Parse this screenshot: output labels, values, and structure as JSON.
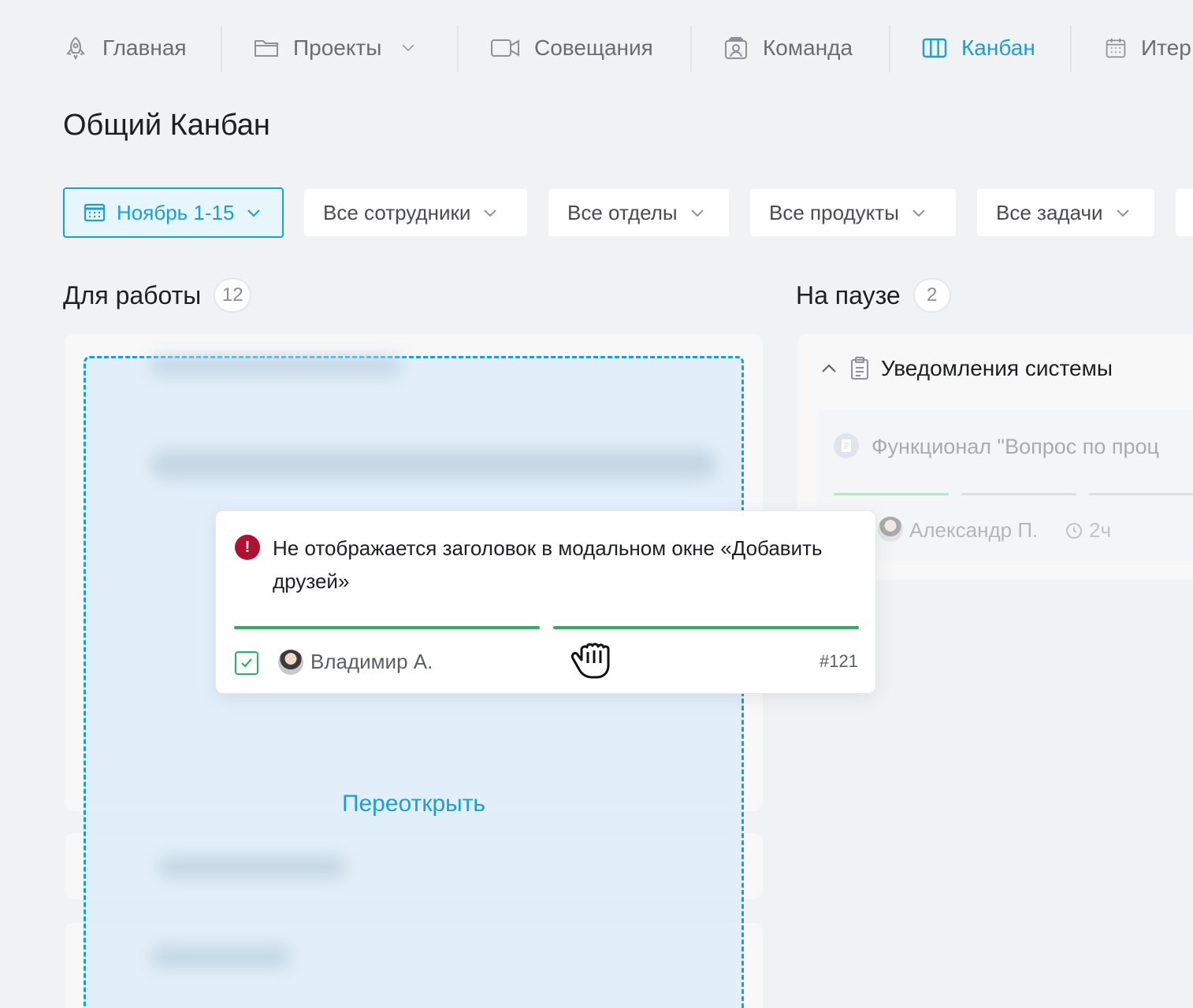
{
  "nav": {
    "items": [
      {
        "label": "Главная",
        "icon": "rocket-icon"
      },
      {
        "label": "Проекты",
        "icon": "folder-icon"
      },
      {
        "label": "Совещания",
        "icon": "video-camera-icon"
      },
      {
        "label": "Команда",
        "icon": "team-badge-icon"
      },
      {
        "label": "Канбан",
        "icon": "kanban-columns-icon",
        "active": true
      },
      {
        "label": "Итер",
        "icon": "calendar-icon"
      }
    ]
  },
  "page": {
    "title": "Общий Канбан"
  },
  "filters": {
    "period": "Ноябрь 1-15",
    "employees": "Все сотрудники",
    "departments": "Все отделы",
    "products": "Все продукты",
    "tasks": "Все задачи"
  },
  "columns": [
    {
      "title": "Для работы",
      "count": "12"
    },
    {
      "title": "На паузе",
      "count": "2"
    }
  ],
  "drop_zone": {
    "label": "Переоткрыть"
  },
  "dragged_card": {
    "title": "Не отображается заголовок в модальном окне «Добавить друзей»",
    "priority_icon": "!",
    "assignee": "Владимир А.",
    "id": "#121",
    "progress": [
      1.0,
      1.0
    ]
  },
  "pause_group": {
    "title": "Уведомления системы",
    "card": {
      "title": "Функционал \"Вопрос по проц",
      "assignee": "Александр П.",
      "time": "2ч"
    }
  },
  "colors": {
    "accent": "#1b9fd8",
    "success": "#27b25e",
    "danger": "#b01031"
  }
}
